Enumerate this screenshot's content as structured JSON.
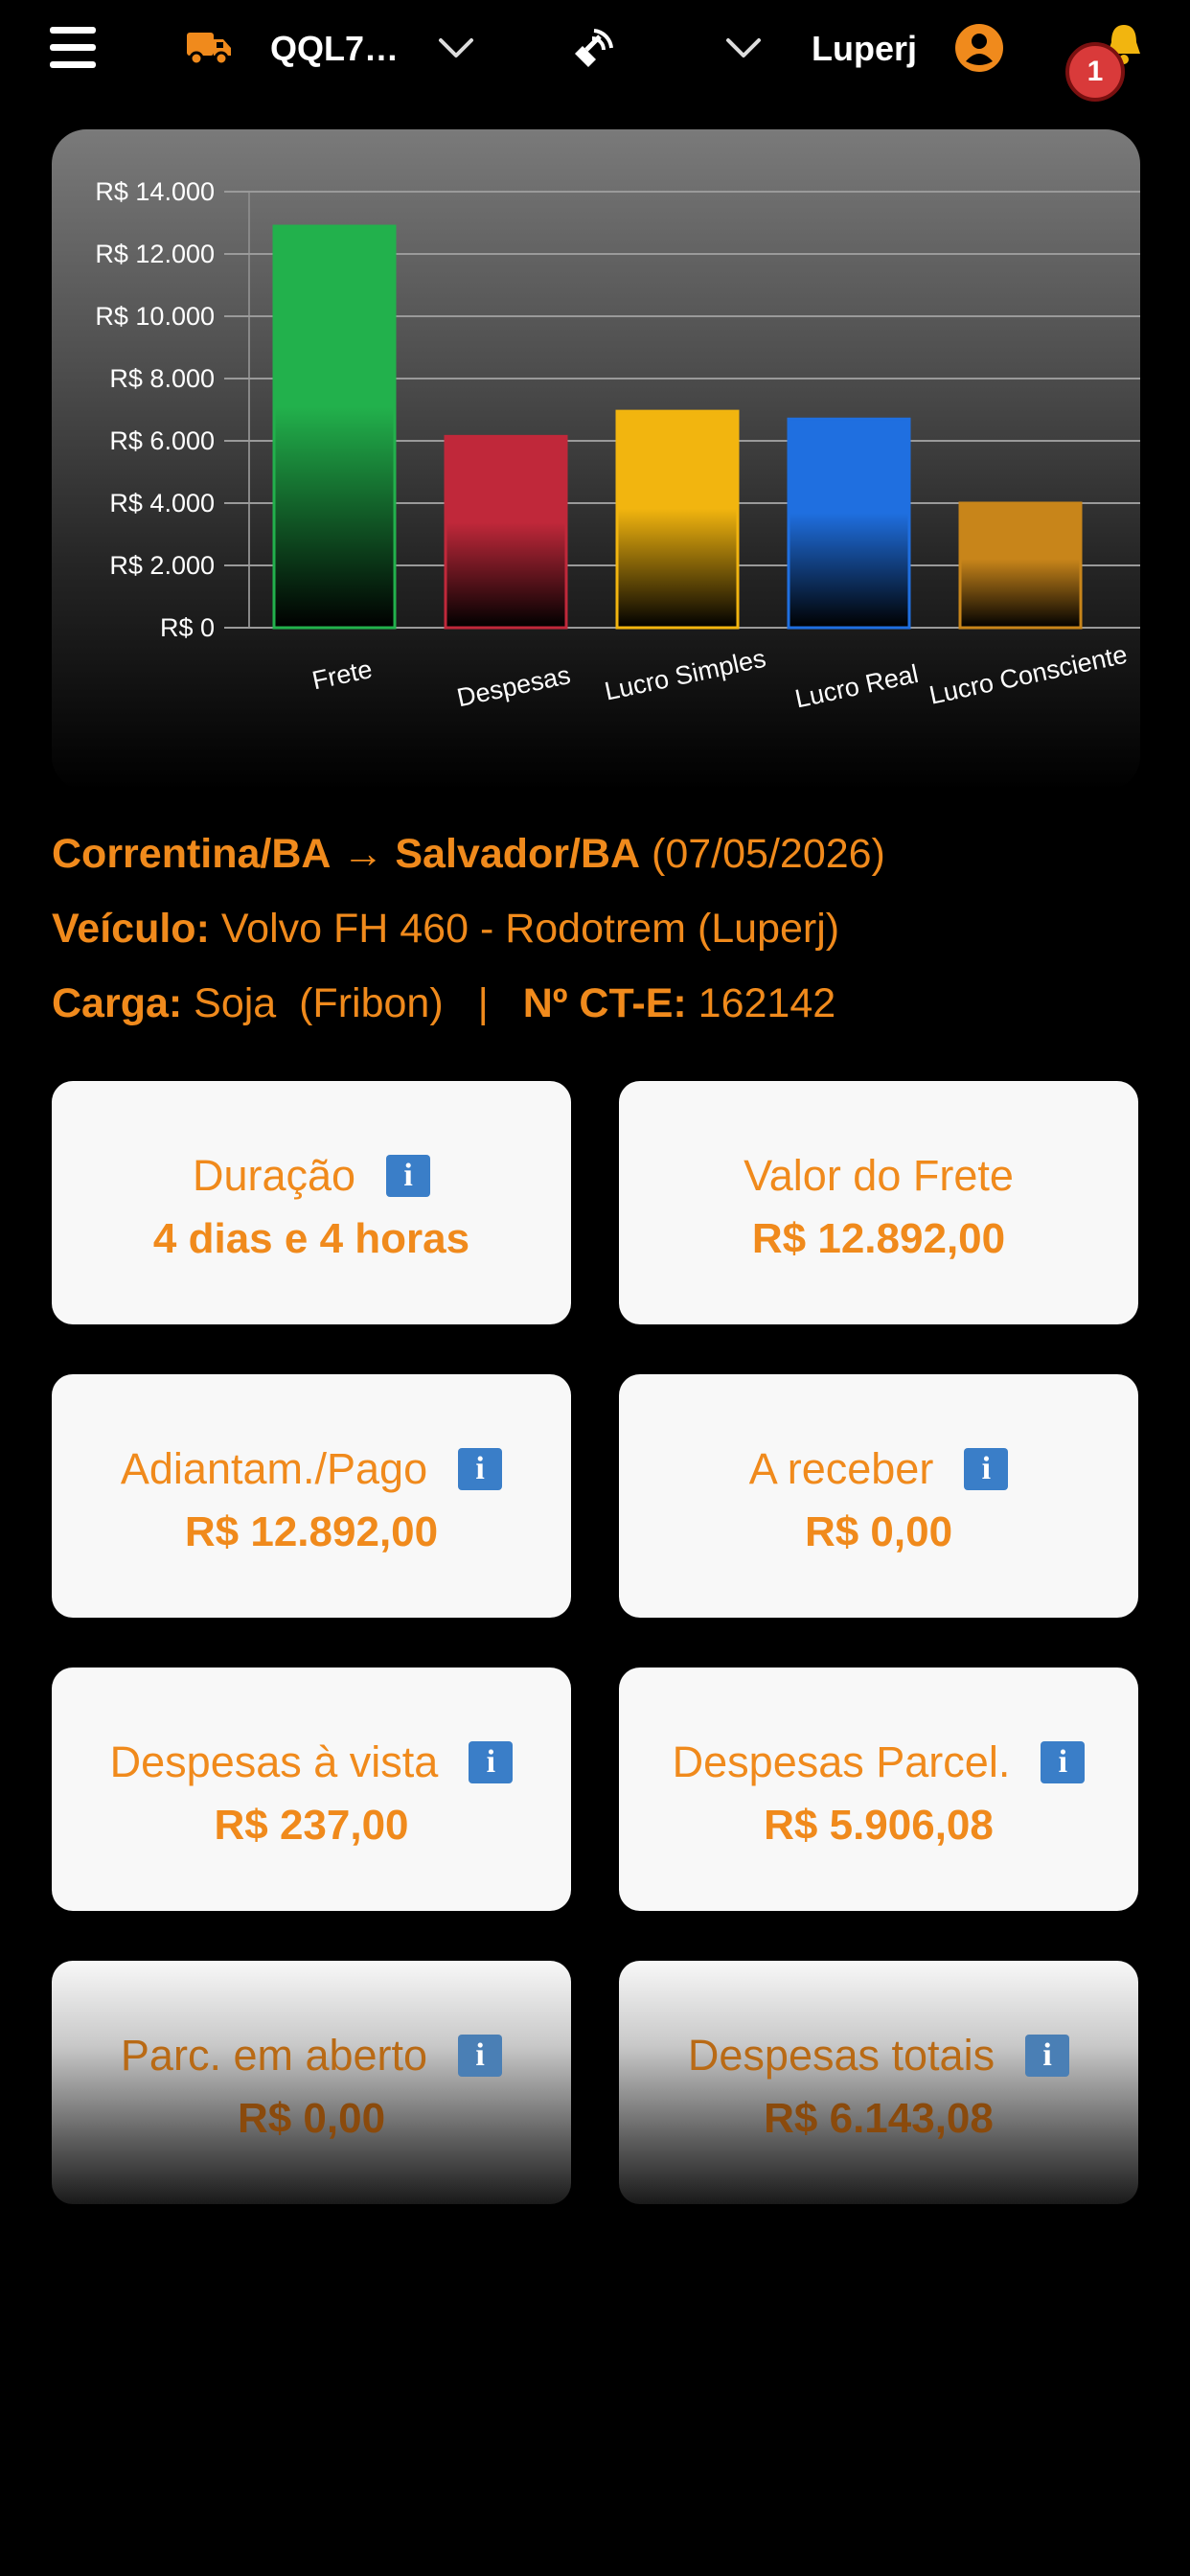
{
  "header": {
    "vehicle_plate": "QQL7…",
    "company": "Luperj",
    "notification_count": "1",
    "icons": [
      "menu-icon",
      "truck-icon",
      "chevron-down-icon",
      "tracker-icon",
      "chevron-down-icon",
      "user-icon",
      "bell-icon"
    ]
  },
  "colors": {
    "accent": "#f08a1c",
    "frete": "#22b14c",
    "despesas": "#c0283a",
    "lucro_simples": "#f2b50f",
    "lucro_real": "#1f6fe0",
    "lucro_consciente": "#c8851a",
    "info": "#3a7ec8"
  },
  "chart_data": {
    "type": "bar",
    "categories": [
      "Frete",
      "Despesas",
      "Lucro Simples",
      "Lucro Real",
      "Lucro Consciente"
    ],
    "values": [
      12892.0,
      6143.08,
      6950,
      6700,
      4000
    ],
    "ylim": [
      0,
      14000
    ],
    "yticks": [
      {
        "value": 0,
        "label": "R$ 0"
      },
      {
        "value": 2000,
        "label": "R$ 2.000"
      },
      {
        "value": 4000,
        "label": "R$ 4.000"
      },
      {
        "value": 6000,
        "label": "R$ 6.000"
      },
      {
        "value": 8000,
        "label": "R$ 8.000"
      },
      {
        "value": 10000,
        "label": "R$ 10.000"
      },
      {
        "value": 12000,
        "label": "R$ 12.000"
      },
      {
        "value": 14000,
        "label": "R$ 14.000"
      }
    ],
    "grid": true,
    "title": "",
    "xlabel": "",
    "ylabel": ""
  },
  "trip": {
    "origin": "Correntina/BA",
    "arrow": "→",
    "destination": "Salvador/BA",
    "date": "(07/05/2026)",
    "vehicle_label": "Veículo:",
    "vehicle_value": "Volvo FH 460 - Rodotrem (Luperj)",
    "cargo_label": "Carga:",
    "cargo_value": "Soja  (Fribon)",
    "separator": "|",
    "cte_label": "Nº CT-E:",
    "cte_value": "162142"
  },
  "stats": [
    {
      "label": "Duração",
      "value": "4 dias e 4 horas",
      "info": true
    },
    {
      "label": "Valor do Frete",
      "value": "R$ 12.892,00",
      "info": false
    },
    {
      "label": "Adiantam./Pago",
      "value": "R$ 12.892,00",
      "info": true
    },
    {
      "label": "A receber",
      "value": "R$ 0,00",
      "info": true
    },
    {
      "label": "Despesas à vista",
      "value": "R$ 237,00",
      "info": true
    },
    {
      "label": "Despesas Parcel.",
      "value": "R$ 5.906,08",
      "info": true
    },
    {
      "label": "Parc. em aberto",
      "value": "R$ 0,00",
      "info": true
    },
    {
      "label": "Despesas totais",
      "value": "R$ 6.143,08",
      "info": true
    }
  ],
  "info_glyph": "i"
}
